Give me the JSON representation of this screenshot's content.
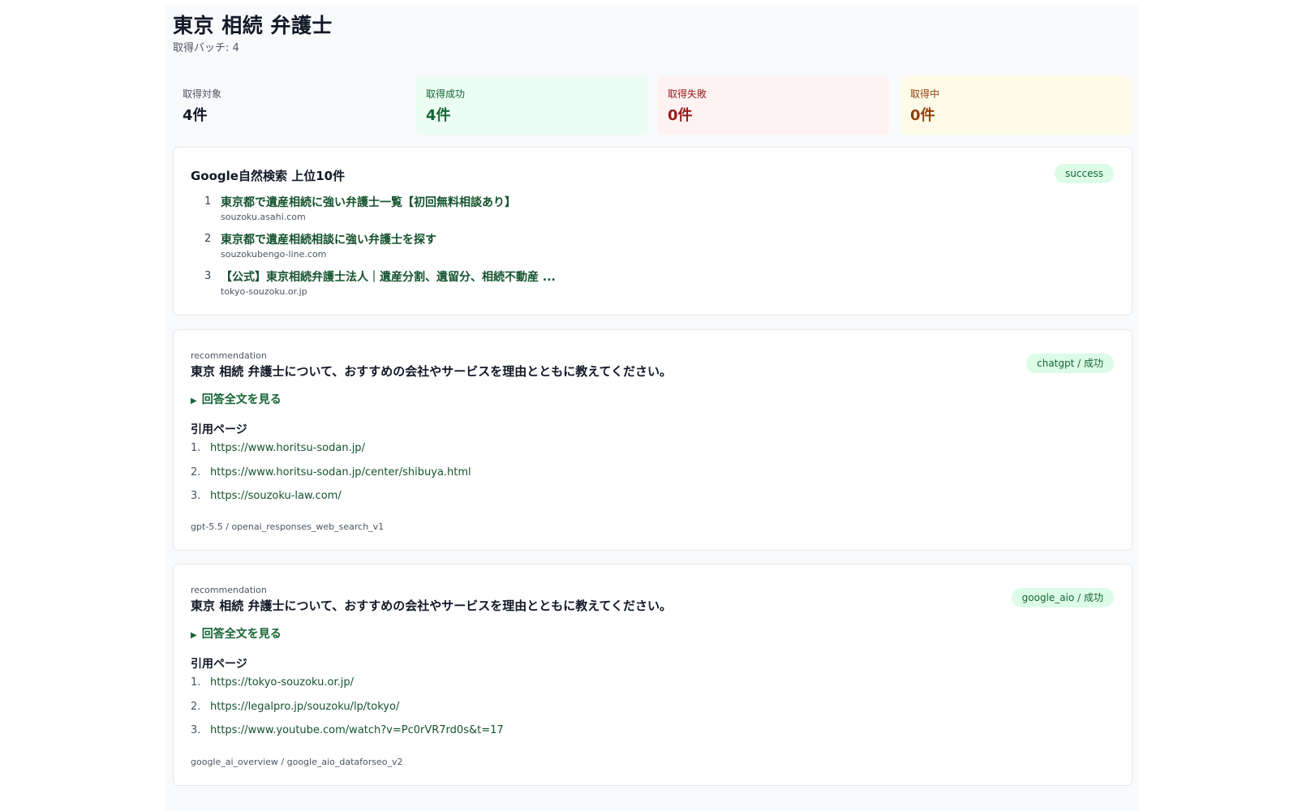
{
  "page": {
    "title": "東京 相続 弁護士",
    "subtitle": "取得バッチ: 4"
  },
  "stats": {
    "target": {
      "label": "取得対象",
      "value": "4件"
    },
    "success": {
      "label": "取得成功",
      "value": "4件"
    },
    "failed": {
      "label": "取得失敗",
      "value": "0件"
    },
    "pending": {
      "label": "取得中",
      "value": "0件"
    }
  },
  "serp": {
    "heading": "Google自然検索 上位10件",
    "badge": "success",
    "results": [
      {
        "rank": "1",
        "title": "東京都で遺産相続に強い弁護士一覧【初回無料相談あり】",
        "domain": "souzoku.asahi.com"
      },
      {
        "rank": "2",
        "title": "東京都で遺産相続相談に強い弁護士を探す",
        "domain": "souzokubengo-line.com"
      },
      {
        "rank": "3",
        "title": "【公式】東京相続弁護士法人｜遺産分割、遺留分、相続不動産 ...",
        "domain": "tokyo-souzoku.or.jp"
      }
    ]
  },
  "responses": [
    {
      "kind": "recommendation",
      "prompt": "東京 相続 弁護士について、おすすめの会社やサービスを理由とともに教えてください。",
      "badge": "chatgpt / 成功",
      "toggle": "回答全文を見る",
      "cited_heading": "引用ページ",
      "cited": [
        {
          "num": "1.",
          "url": "https://www.horitsu-sodan.jp/"
        },
        {
          "num": "2.",
          "url": "https://www.horitsu-sodan.jp/center/shibuya.html"
        },
        {
          "num": "3.",
          "url": "https://souzoku-law.com/"
        }
      ],
      "meta": "gpt-5.5 / openai_responses_web_search_v1"
    },
    {
      "kind": "recommendation",
      "prompt": "東京 相続 弁護士について、おすすめの会社やサービスを理由とともに教えてください。",
      "badge": "google_aio / 成功",
      "toggle": "回答全文を見る",
      "cited_heading": "引用ページ",
      "cited": [
        {
          "num": "1.",
          "url": "https://tokyo-souzoku.or.jp/"
        },
        {
          "num": "2.",
          "url": "https://legalpro.jp/souzoku/lp/tokyo/"
        },
        {
          "num": "3.",
          "url": "https://www.youtube.com/watch?v=Pc0rVR7rd0s&t=17"
        }
      ],
      "meta": "google_ai_overview / google_aio_dataforseo_v2"
    }
  ],
  "colors": {
    "accent_green": "#166534",
    "link_green": "#14532d",
    "badge_bg": "#dcfce7",
    "success_bg": "#ecfdf3",
    "failed_bg": "#fef2f2",
    "pending_bg": "#fefce8"
  },
  "icons": {
    "toggle": "disclosure-triangle-icon"
  }
}
